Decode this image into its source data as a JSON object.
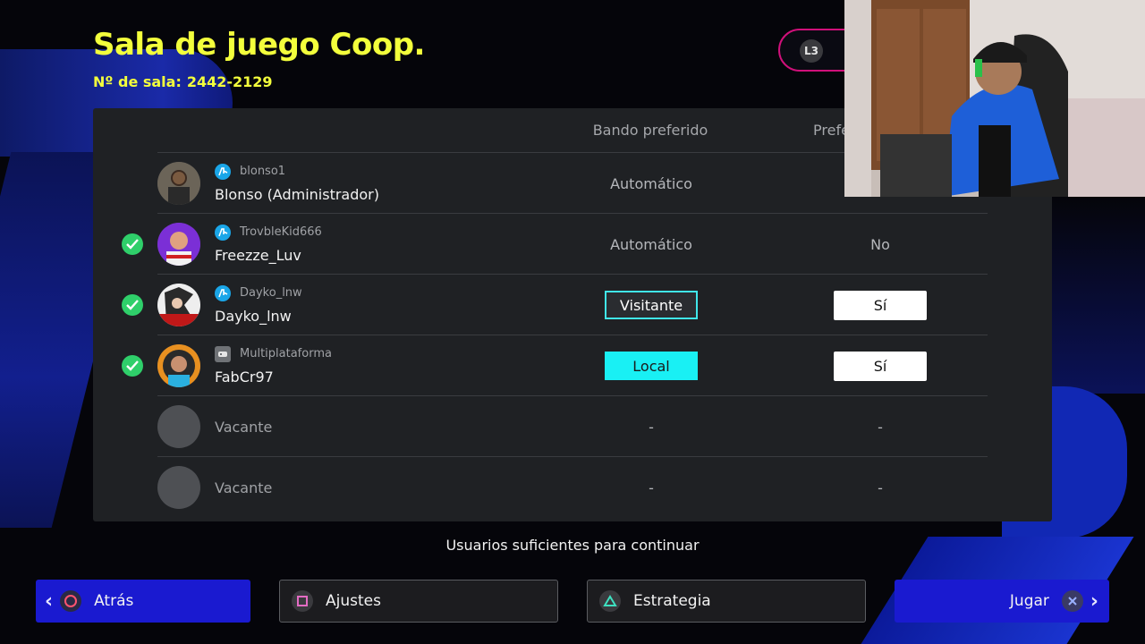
{
  "header": {
    "title": "Sala de juego Coop.",
    "room_label": "Nº de sala:",
    "room_number": "2442-2129",
    "l3_label": "L3"
  },
  "table": {
    "col_side": "Bando preferido",
    "col_pref": "Prefe"
  },
  "rows": [
    {
      "platform": "playstation",
      "user_id": "blonso1",
      "name": "Blonso (Administrador)",
      "side": "Automático",
      "pref": "",
      "ready": false
    },
    {
      "platform": "playstation",
      "user_id": "TrovbleKid666",
      "name": "Freezze_Luv",
      "side": "Automático",
      "pref": "No",
      "ready": true
    },
    {
      "platform": "playstation",
      "user_id": "Dayko_lnw",
      "name": "Dayko_lnw",
      "side": "Visitante",
      "pref": "Sí",
      "ready": true
    },
    {
      "platform": "multiplatform",
      "user_id": "Multiplataforma",
      "name": "FabCr97",
      "side": "Local",
      "pref": "Sí",
      "ready": true
    },
    {
      "name": "Vacante",
      "side": "-",
      "pref": "-"
    },
    {
      "name": "Vacante",
      "side": "-",
      "pref": "-"
    }
  ],
  "status_text": "Usuarios suficientes para continuar",
  "footer": {
    "back_label": "Atrás",
    "settings_label": "Ajustes",
    "strategy_label": "Estrategia",
    "play_label": "Jugar"
  },
  "colors": {
    "title": "#f3ff3c",
    "accent_blue": "#1a1ad0",
    "cyan": "#19f0f4",
    "ready_green": "#2fcf6a"
  }
}
